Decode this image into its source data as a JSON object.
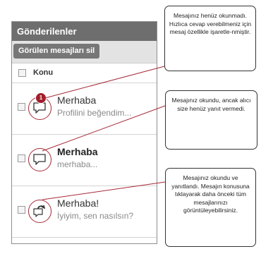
{
  "panel": {
    "title": "Gönderilenler",
    "seen_button_label": "Görülen mesajları sil",
    "column_header": "Konu"
  },
  "messages": [
    {
      "subject": "Merhaba",
      "preview": "Profilini beğendim...",
      "unread_badge": "1",
      "status_icon": "speech-bubble-icon",
      "read": false
    },
    {
      "subject": "Merhaba",
      "preview": "merhaba...",
      "status_icon": "speech-bubble-icon",
      "read": true
    },
    {
      "subject": "Merhaba!",
      "preview": "İyiyim, sen nasılsın?",
      "status_icon": "reply-arrow-icon",
      "read": true
    }
  ],
  "callouts": [
    "Mesajınız henüz okunmadı. Hızlıca cevap verebilmeniz için mesaj özellikle işaretle-nmiştir.",
    "Mesajınız okundu, ancak alıcı size henüz yanıt vermedi.",
    "Mesajınız okundu ve yanıtlandı. Mesajın konusuna tıklayarak daha önceki tüm mesajlarınızı görüntüleyebilirsiniz."
  ],
  "colors": {
    "accent": "#a52a36",
    "titlebar": "#6e6e6e",
    "button": "#777777"
  }
}
